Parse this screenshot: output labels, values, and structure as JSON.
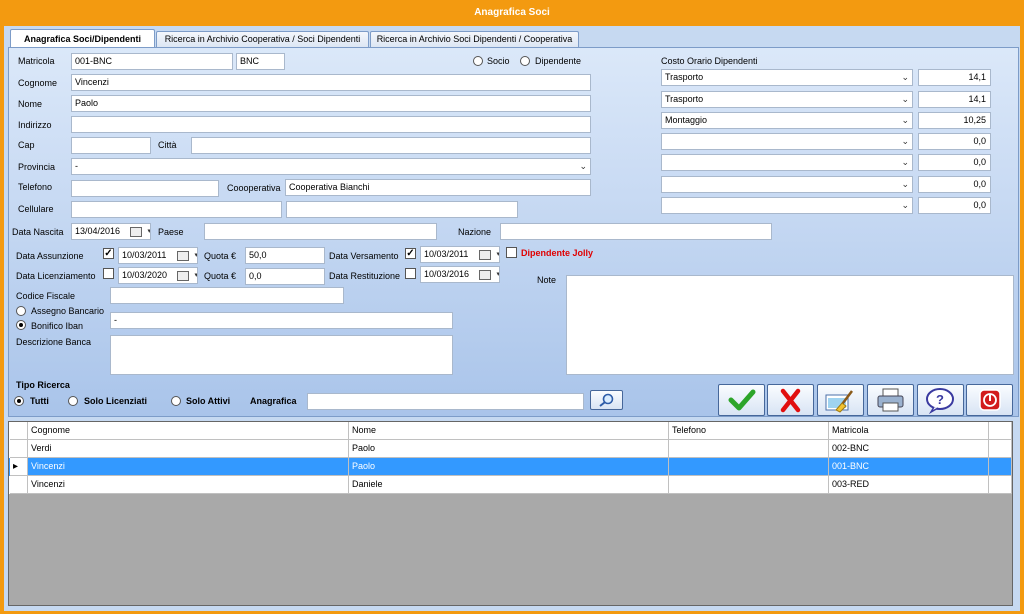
{
  "window": {
    "title": "Anagrafica Soci"
  },
  "tabs": [
    {
      "label": "Anagrafica Soci/Dipendenti"
    },
    {
      "label": "Ricerca in Archivio Cooperativa / Soci Dipendenti"
    },
    {
      "label": "Ricerca in Archivio Soci Dipendenti / Cooperativa"
    }
  ],
  "form": {
    "matricola_label": "Matricola",
    "matricola_value": "001-BNC",
    "matricola_suffix": "BNC",
    "socio_label": "Socio",
    "dipendente_label": "Dipendente",
    "cognome_label": "Cognome",
    "cognome_value": "Vincenzi",
    "nome_label": "Nome",
    "nome_value": "Paolo",
    "indirizzo_label": "Indirizzo",
    "indirizzo_value": "",
    "cap_label": "Cap",
    "cap_value": "",
    "citta_label": "Città",
    "citta_value": "",
    "provincia_label": "Provincia",
    "provincia_value": "-",
    "telefono_label": "Telefono",
    "telefono_value": "",
    "cooperativa_label": "Coooperativa",
    "cooperativa_value": "Cooperativa Bianchi",
    "cellulare_label": "Cellulare",
    "cellulare_value": "",
    "extra_value": "",
    "data_nascita_label": "Data Nascita",
    "data_nascita_value": "13/04/2016",
    "paese_label": "Paese",
    "paese_value": "",
    "nazione_label": "Nazione",
    "nazione_value": "",
    "data_assunzione_label": "Data Assunzione",
    "data_assunzione_value": "10/03/2011",
    "quota1_label": "Quota €",
    "quota1_value": "50,0",
    "data_versamento_label": "Data Versamento",
    "data_versamento_value": "10/03/2011",
    "dipendente_jolly_label": "Dipendente Jolly",
    "data_licenziamento_label": "Data Licenziamento",
    "data_licenziamento_value": "10/03/2020",
    "quota2_label": "Quota €",
    "quota2_value": "0,0",
    "data_restituzione_label": "Data Restituzione",
    "data_restituzione_value": "10/03/2016",
    "codice_fiscale_label": "Codice Fiscale",
    "codice_fiscale_value": "",
    "assegno_label": "Assegno Bancario",
    "bonifico_label": "Bonifico Iban",
    "iban_value": "-",
    "descrizione_banca_label": "Descrizione Banca",
    "descrizione_banca_value": "",
    "note_label": "Note",
    "note_value": ""
  },
  "costo_orario": {
    "label": "Costo Orario Dipendenti",
    "rows": [
      {
        "type": "Trasporto",
        "value": "14,1"
      },
      {
        "type": "Trasporto",
        "value": "14,1"
      },
      {
        "type": "Montaggio",
        "value": "10,25"
      },
      {
        "type": "",
        "value": "0,0"
      },
      {
        "type": "",
        "value": "0,0"
      },
      {
        "type": "",
        "value": "0,0"
      },
      {
        "type": "",
        "value": "0,0"
      }
    ]
  },
  "ricerca": {
    "label": "Tipo Ricerca",
    "tutti": "Tutti",
    "solo_licenziati": "Solo Licenziati",
    "solo_attivi": "Solo Attivi",
    "anagrafica_label": "Anagrafica",
    "anagrafica_value": ""
  },
  "toolbar": [
    "confirm-icon",
    "cancel-icon",
    "clear-icon",
    "print-icon",
    "help-icon",
    "exit-icon"
  ],
  "table": {
    "columns": [
      "Cognome",
      "Nome",
      "Telefono",
      "Matricola"
    ],
    "rows": [
      [
        "Verdi",
        "Paolo",
        "",
        "002-BNC"
      ],
      [
        "Vincenzi",
        "Paolo",
        "",
        "001-BNC"
      ],
      [
        "Vincenzi",
        "Daniele",
        "",
        "003-RED"
      ]
    ],
    "selected_index": 1
  },
  "colors": {
    "title_bar": "#f39a10",
    "selection": "#3399ff",
    "jolly": "#e00000"
  }
}
